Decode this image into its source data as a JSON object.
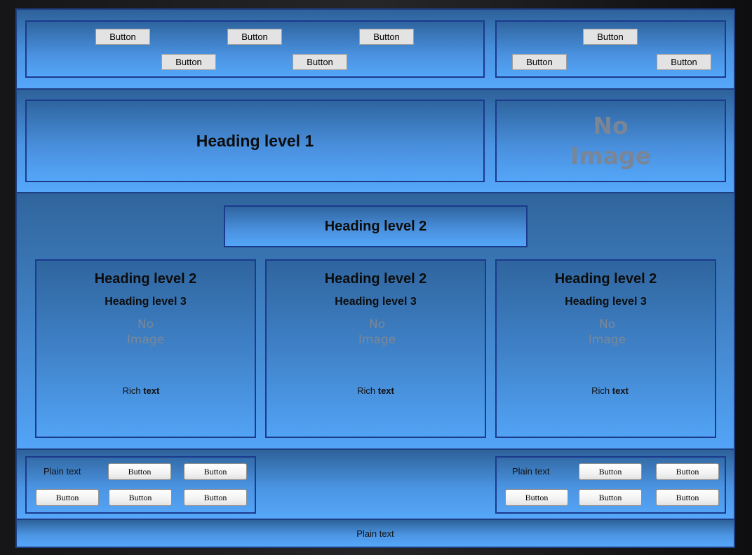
{
  "header": {
    "left_buttons": [
      "Button",
      "Button",
      "Button",
      "Button",
      "Button"
    ],
    "right_buttons": [
      "Button",
      "Button",
      "Button"
    ]
  },
  "hero": {
    "heading1": "Heading level 1",
    "no_image_line1": "No",
    "no_image_line2": "Image"
  },
  "content": {
    "section_heading": "Heading level 2",
    "cards": [
      {
        "heading2": "Heading level 2",
        "heading3": "Heading level 3",
        "no_image_line1": "No",
        "no_image_line2": "Image",
        "rich_plain": "Rich ",
        "rich_bold": "text"
      },
      {
        "heading2": "Heading level 2",
        "heading3": "Heading level 3",
        "no_image_line1": "No",
        "no_image_line2": "Image",
        "rich_plain": "Rich ",
        "rich_bold": "text"
      },
      {
        "heading2": "Heading level 2",
        "heading3": "Heading level 3",
        "no_image_line1": "No",
        "no_image_line2": "Image",
        "rich_plain": "Rich ",
        "rich_bold": "text"
      }
    ]
  },
  "toolbar": {
    "left": {
      "label": "Plain text",
      "buttons": [
        "Button",
        "Button",
        "Button",
        "Button",
        "Button"
      ]
    },
    "right": {
      "label": "Plain text",
      "buttons": [
        "Button",
        "Button",
        "Button",
        "Button",
        "Button"
      ]
    }
  },
  "footer": {
    "text": "Plain text"
  }
}
